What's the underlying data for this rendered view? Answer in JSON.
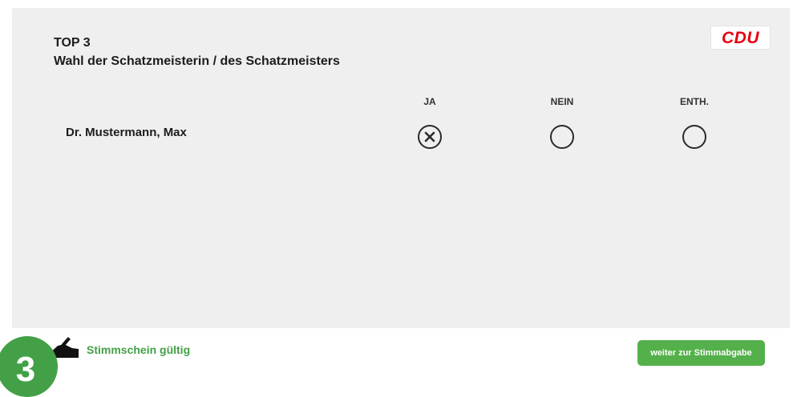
{
  "logo": {
    "text": "CDU",
    "color": "#e3000f"
  },
  "agenda": {
    "top_label": "TOP 3",
    "title": "Wahl der Schatzmeisterin / des Schatzmeisters"
  },
  "ballot": {
    "columns": [
      "JA",
      "NEIN",
      "ENTH."
    ],
    "candidates": [
      {
        "name": "Dr. Mustermann, Max",
        "selected": "JA"
      }
    ]
  },
  "footer": {
    "status_text": "Stimmschein gültig",
    "status_icon": "hand-writing-icon",
    "continue_label": "weiter zur Stimmabgabe",
    "accent_color": "#54b04a"
  },
  "step_badge": {
    "number": "3"
  }
}
